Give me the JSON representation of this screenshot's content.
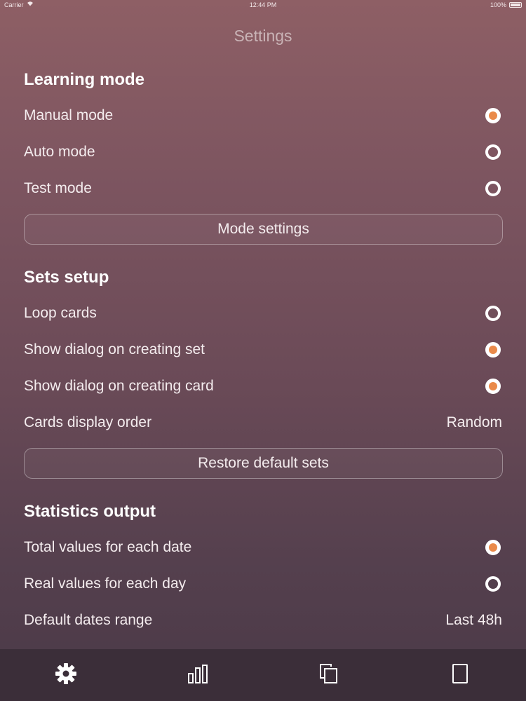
{
  "status_bar": {
    "carrier": "Carrier",
    "time": "12:44 PM",
    "battery": "100%"
  },
  "nav": {
    "title": "Settings"
  },
  "learning_mode": {
    "title": "Learning mode",
    "options": [
      {
        "label": "Manual mode",
        "selected": true
      },
      {
        "label": "Auto mode",
        "selected": false
      },
      {
        "label": "Test mode",
        "selected": false
      }
    ],
    "button_label": "Mode settings"
  },
  "sets_setup": {
    "title": "Sets setup",
    "options": [
      {
        "label": "Loop cards",
        "selected": false
      },
      {
        "label": "Show dialog on creating set",
        "selected": true
      },
      {
        "label": "Show dialog on creating card",
        "selected": true
      }
    ],
    "display_order": {
      "label": "Cards display order",
      "value": "Random"
    },
    "button_label": "Restore default sets"
  },
  "statistics_output": {
    "title": "Statistics output",
    "options": [
      {
        "label": "Total values for each date",
        "selected": true
      },
      {
        "label": "Real values for each day",
        "selected": false
      }
    ],
    "dates_range": {
      "label": "Default dates range",
      "value": "Last 48h"
    }
  },
  "tab_bar": {
    "tabs": [
      {
        "icon": "gear-icon",
        "active": true
      },
      {
        "icon": "bar-chart-icon",
        "active": false
      },
      {
        "icon": "copy-cards-icon",
        "active": false
      },
      {
        "icon": "card-icon",
        "active": false
      }
    ]
  },
  "colors": {
    "accent": "#ea8a4a",
    "tab_bar_bg": "#3b2e39",
    "background_top": "#8e5f65",
    "background_bottom": "#4a3947"
  }
}
